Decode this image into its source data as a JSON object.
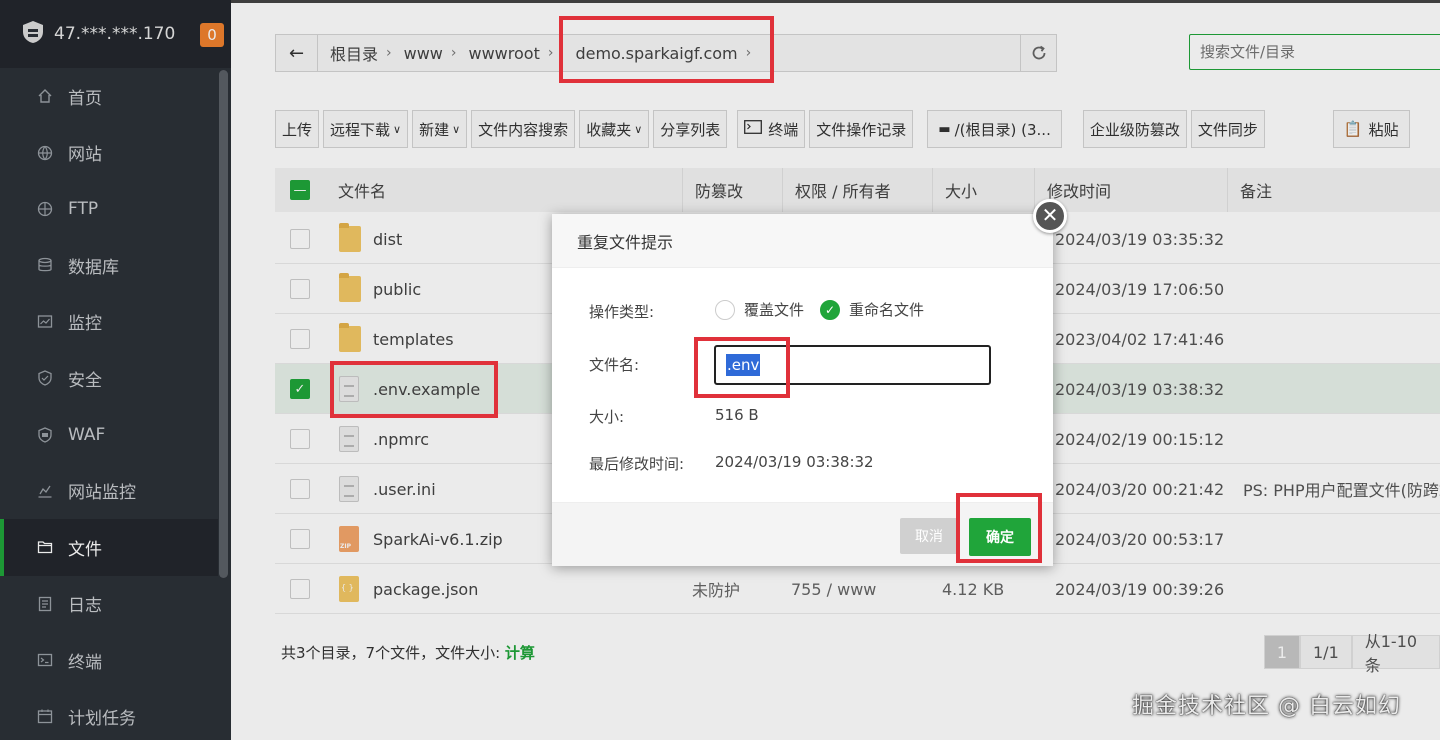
{
  "sidebar": {
    "server_ip": "47.***.***.170",
    "badge_count": "0",
    "items": [
      {
        "label": "首页",
        "icon": "home-icon"
      },
      {
        "label": "网站",
        "icon": "globe-icon"
      },
      {
        "label": "FTP",
        "icon": "ftp-icon"
      },
      {
        "label": "数据库",
        "icon": "database-icon"
      },
      {
        "label": "监控",
        "icon": "monitor-icon"
      },
      {
        "label": "安全",
        "icon": "shield-icon"
      },
      {
        "label": "WAF",
        "icon": "waf-icon"
      },
      {
        "label": "网站监控",
        "icon": "chart-icon"
      },
      {
        "label": "文件",
        "icon": "folder-icon",
        "active": true
      },
      {
        "label": "日志",
        "icon": "log-icon"
      },
      {
        "label": "终端",
        "icon": "terminal-icon"
      },
      {
        "label": "计划任务",
        "icon": "calendar-icon"
      }
    ]
  },
  "path": {
    "crumbs": [
      "根目录",
      "www",
      "wwwroot",
      "demo.sparkaigf.com"
    ]
  },
  "search": {
    "placeholder": "搜索文件/目录"
  },
  "toolbar": {
    "upload": "上传",
    "remote_download": "远程下载",
    "new": "新建",
    "content_search": "文件内容搜索",
    "favorites": "收藏夹",
    "share_list": "分享列表",
    "terminal": "终端",
    "op_log": "文件操作记录",
    "disk": "/(根目录) (3...",
    "tamper": "企业级防篡改",
    "sync": "文件同步",
    "paste": "粘贴"
  },
  "table": {
    "headers": {
      "name": "文件名",
      "protect": "防篡改",
      "perm": "权限 / 所有者",
      "size": "大小",
      "mtime": "修改时间",
      "note": "备注"
    },
    "rows": [
      {
        "name": "dist",
        "type": "folder",
        "protect": "",
        "perm": "",
        "size": "",
        "mtime": "2024/03/19 03:35:32",
        "note": ""
      },
      {
        "name": "public",
        "type": "folder",
        "protect": "",
        "perm": "",
        "size": "",
        "mtime": "2024/03/19 17:06:50",
        "note": ""
      },
      {
        "name": "templates",
        "type": "folder",
        "protect": "",
        "perm": "",
        "size": "",
        "mtime": "2023/04/02 17:41:46",
        "note": ""
      },
      {
        "name": ".env.example",
        "type": "file",
        "selected": true,
        "protect": "",
        "perm": "",
        "size": "",
        "mtime": "2024/03/19 03:38:32",
        "note": ""
      },
      {
        "name": ".npmrc",
        "type": "file",
        "protect": "",
        "perm": "",
        "size": "",
        "mtime": "2024/02/19 00:15:12",
        "note": ""
      },
      {
        "name": ".user.ini",
        "type": "file",
        "protect": "",
        "perm": "",
        "size": "",
        "mtime": "2024/03/20 00:21:42",
        "note": "PS: PHP用户配置文件(防跨站"
      },
      {
        "name": "SparkAi-v6.1.zip",
        "type": "zip",
        "protect": "",
        "perm": "",
        "size": "",
        "mtime": "2024/03/20 00:53:17",
        "note": ""
      },
      {
        "name": "package.json",
        "type": "json",
        "protect": "未防护",
        "perm": "755 / www",
        "size": "4.12 KB",
        "mtime": "2024/03/19 00:39:26",
        "note": ""
      }
    ]
  },
  "footer": {
    "summary": "共3个目录，7个文件，文件大小: ",
    "calc": "计算",
    "page_current": "1",
    "page_total": "1/1",
    "page_range": "从1-10条"
  },
  "dialog": {
    "title": "重复文件提示",
    "op_type_label": "操作类型:",
    "opt_overwrite": "覆盖文件",
    "opt_rename": "重命名文件",
    "filename_label": "文件名:",
    "filename_value": ".env",
    "size_label": "大小:",
    "size_value": "516 B",
    "mtime_label": "最后修改时间:",
    "mtime_value": "2024/03/19 03:38:32",
    "cancel": "取消",
    "confirm": "确定"
  },
  "watermark": "掘金技术社区 @ 白云如幻",
  "colors": {
    "accent": "#20a53a",
    "highlight": "#e0313a",
    "sidebar_bg": "#2c3138",
    "badge": "#f0822e"
  }
}
